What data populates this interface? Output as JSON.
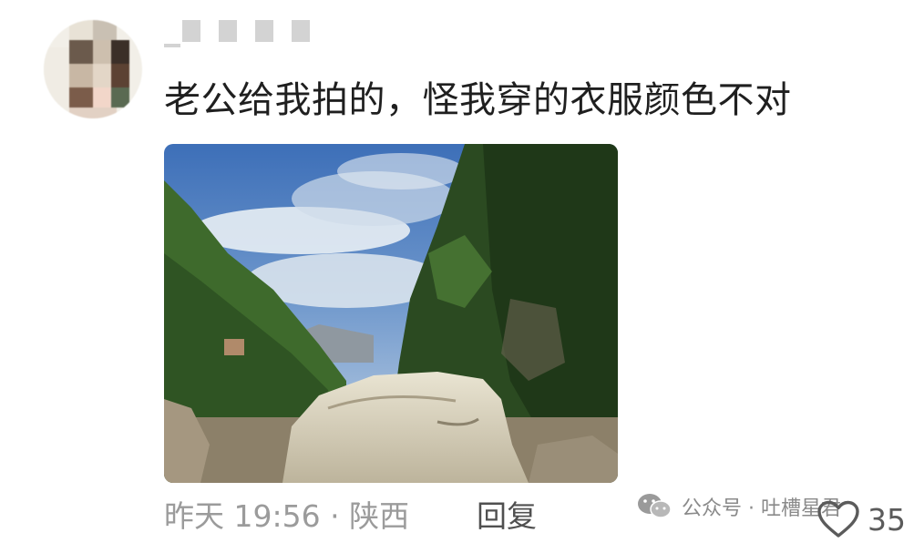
{
  "comment": {
    "text": "老公给我拍的，怪我穿的衣服颜色不对",
    "timestamp": "昨天 19:56",
    "location_separator": "·",
    "location": "陕西",
    "reply_label": "回复",
    "like_count": "35"
  },
  "watermark": {
    "icon": "wechat-icon",
    "text": "公众号 · 吐槽星君"
  },
  "icons": {
    "like": "heart-icon"
  },
  "colors": {
    "text_primary": "#1f1f1f",
    "text_meta": "#9b9b9b",
    "reply": "#505050",
    "background": "#ffffff"
  }
}
